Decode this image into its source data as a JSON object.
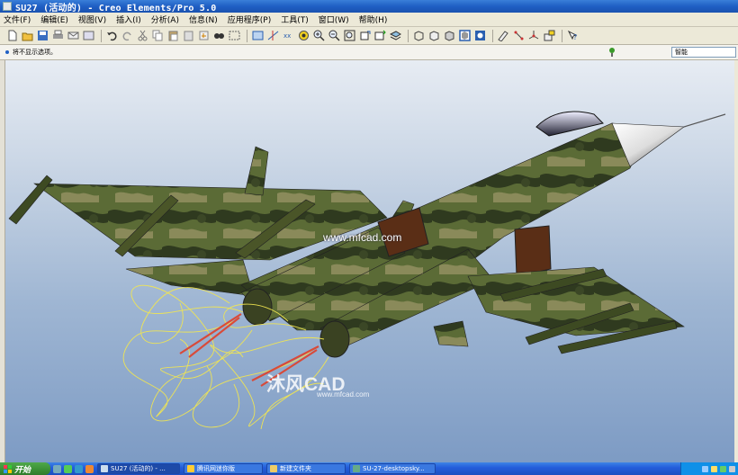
{
  "window": {
    "title": "SU27 (活动的) - Creo Elements/Pro 5.0"
  },
  "menu": [
    "文件(F)",
    "编辑(E)",
    "视图(V)",
    "插入(I)",
    "分析(A)",
    "信息(N)",
    "应用程序(P)",
    "工具(T)",
    "窗口(W)",
    "帮助(H)"
  ],
  "toolbar": {
    "groups": [
      [
        "new-icon",
        "open-icon",
        "save-icon",
        "print-icon",
        "email-icon",
        "close-window-icon"
      ],
      [
        "undo-icon",
        "redo-icon",
        "cut-icon",
        "copy-icon",
        "paste-icon",
        "paste-special-icon",
        "regenerate-icon",
        "find-icon",
        "select-box-icon"
      ],
      [
        "plane-display-icon",
        "axis-display-icon",
        "point-display-icon",
        "csys-display-icon",
        "zoom-in-icon",
        "zoom-out-icon",
        "refit-icon",
        "reorient-icon",
        "saved-views-icon",
        "layers-icon"
      ],
      [
        "wireframe-icon",
        "hidden-line-icon",
        "no-hidden-icon",
        "shading-icon",
        "enhanced-realism-icon"
      ],
      [
        "sketch-tool-icon",
        "datum-point-icon",
        "csys-tool-icon",
        "analysis-icon"
      ],
      [
        "context-help-icon"
      ]
    ]
  },
  "messages": {
    "current": "将不显示选项。"
  },
  "filter": {
    "value": "智能"
  },
  "watermark": {
    "url_top": "www.mfcad.com",
    "logo_text": "沐风CAD",
    "logo_url": "www.mfcad.com"
  },
  "taskbar": {
    "start_label": "开始",
    "tasks": [
      {
        "label": "SU27 (活动的) - ...",
        "active": true
      },
      {
        "label": "腾讯网迷你版",
        "active": false
      },
      {
        "label": "新建文件夹",
        "active": false
      },
      {
        "label": "SU-27-desktopsky...",
        "active": false
      }
    ]
  },
  "colors": {
    "titlebar": "#1f5fc4",
    "menubar": "#ece9d8",
    "taskbar": "#245edb",
    "start_button": "#3a8f35",
    "viewport_top": "#e7ecf3",
    "viewport_bottom": "#7d9bc4",
    "camo_dark": "#2f3a1f",
    "camo_mid": "#5b6b36",
    "camo_light": "#8a8a5a",
    "exhaust_trail": "#f2e650",
    "afterburner": "#e0402a"
  }
}
